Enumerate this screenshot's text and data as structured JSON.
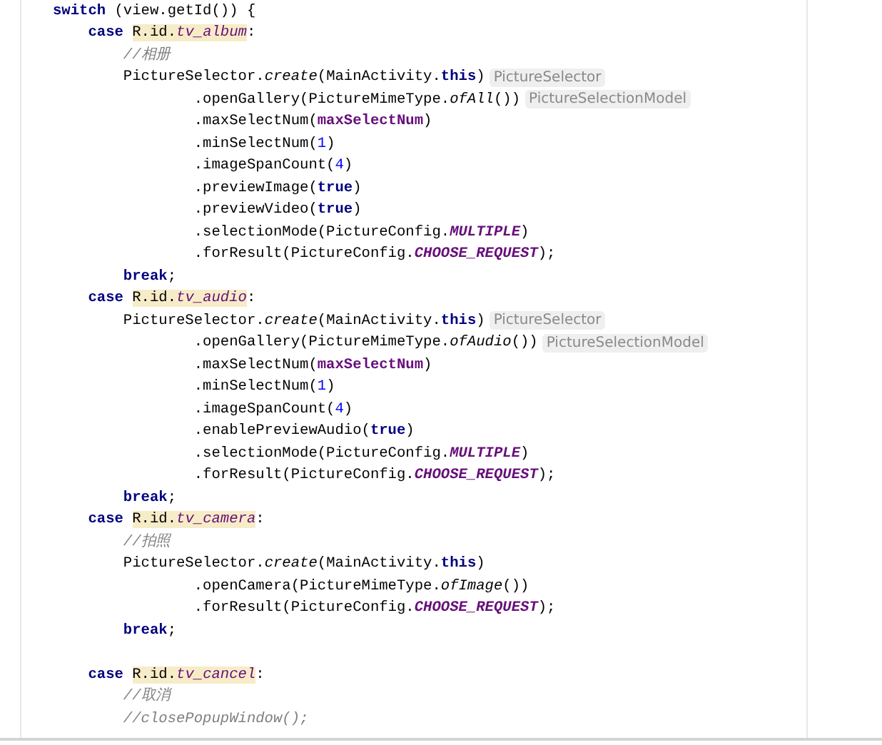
{
  "editor": {
    "lines": [
      {
        "kind": "code",
        "tokens": [
          {
            "kind": "kw",
            "text": "switch"
          },
          {
            "kind": "plain",
            "text": " (view.getId()) {"
          }
        ]
      },
      {
        "kind": "code",
        "tokens": [
          {
            "kind": "kw",
            "text": "    case "
          },
          {
            "kind": "ref",
            "text": "R.id.",
            "name": "tv_album"
          },
          {
            "kind": "plain",
            "text": ":"
          }
        ]
      },
      {
        "kind": "code",
        "tokens": [
          {
            "kind": "comment",
            "text": "        //相册"
          }
        ]
      },
      {
        "kind": "code",
        "tokens": [
          {
            "kind": "plain",
            "text": "        PictureSelector."
          },
          {
            "kind": "italic",
            "text": "create"
          },
          {
            "kind": "plain",
            "text": "(MainActivity."
          },
          {
            "kind": "kw",
            "text": "this"
          },
          {
            "kind": "plain",
            "text": ")"
          }
        ],
        "hint": "PictureSelector"
      },
      {
        "kind": "code",
        "tokens": [
          {
            "kind": "plain",
            "text": "                .openGallery(PictureMimeType."
          },
          {
            "kind": "italic",
            "text": "ofAll"
          },
          {
            "kind": "plain",
            "text": "())"
          }
        ],
        "hint": "PictureSelectionModel"
      },
      {
        "kind": "code",
        "tokens": [
          {
            "kind": "plain",
            "text": "                .maxSelectNum("
          },
          {
            "kind": "field",
            "text": "maxSelectNum"
          },
          {
            "kind": "plain",
            "text": ")"
          }
        ]
      },
      {
        "kind": "code",
        "tokens": [
          {
            "kind": "plain",
            "text": "                .minSelectNum("
          },
          {
            "kind": "num",
            "text": "1"
          },
          {
            "kind": "plain",
            "text": ")"
          }
        ]
      },
      {
        "kind": "code",
        "tokens": [
          {
            "kind": "plain",
            "text": "                .imageSpanCount("
          },
          {
            "kind": "num",
            "text": "4"
          },
          {
            "kind": "plain",
            "text": ")"
          }
        ]
      },
      {
        "kind": "code",
        "tokens": [
          {
            "kind": "plain",
            "text": "                .previewImage("
          },
          {
            "kind": "kw",
            "text": "true"
          },
          {
            "kind": "plain",
            "text": ")"
          }
        ]
      },
      {
        "kind": "code",
        "tokens": [
          {
            "kind": "plain",
            "text": "                .previewVideo("
          },
          {
            "kind": "kw",
            "text": "true"
          },
          {
            "kind": "plain",
            "text": ")"
          }
        ]
      },
      {
        "kind": "code",
        "tokens": [
          {
            "kind": "plain",
            "text": "                .selectionMode(PictureConfig."
          },
          {
            "kind": "const",
            "text": "MULTIPLE"
          },
          {
            "kind": "plain",
            "text": ")"
          }
        ]
      },
      {
        "kind": "code",
        "tokens": [
          {
            "kind": "plain",
            "text": "                .forResult(PictureConfig."
          },
          {
            "kind": "const",
            "text": "CHOOSE_REQUEST"
          },
          {
            "kind": "plain",
            "text": ");"
          }
        ]
      },
      {
        "kind": "code",
        "tokens": [
          {
            "kind": "kw",
            "text": "        break"
          },
          {
            "kind": "plain",
            "text": ";"
          }
        ]
      },
      {
        "kind": "code",
        "tokens": [
          {
            "kind": "kw",
            "text": "    case "
          },
          {
            "kind": "ref",
            "text": "R.id.",
            "name": "tv_audio"
          },
          {
            "kind": "plain",
            "text": ":"
          }
        ]
      },
      {
        "kind": "code",
        "tokens": [
          {
            "kind": "plain",
            "text": "        PictureSelector."
          },
          {
            "kind": "italic",
            "text": "create"
          },
          {
            "kind": "plain",
            "text": "(MainActivity."
          },
          {
            "kind": "kw",
            "text": "this"
          },
          {
            "kind": "plain",
            "text": ")"
          }
        ],
        "hint": "PictureSelector"
      },
      {
        "kind": "code",
        "tokens": [
          {
            "kind": "plain",
            "text": "                .openGallery(PictureMimeType."
          },
          {
            "kind": "italic",
            "text": "ofAudio"
          },
          {
            "kind": "plain",
            "text": "())"
          }
        ],
        "hint": "PictureSelectionModel"
      },
      {
        "kind": "code",
        "tokens": [
          {
            "kind": "plain",
            "text": "                .maxSelectNum("
          },
          {
            "kind": "field",
            "text": "maxSelectNum"
          },
          {
            "kind": "plain",
            "text": ")"
          }
        ]
      },
      {
        "kind": "code",
        "tokens": [
          {
            "kind": "plain",
            "text": "                .minSelectNum("
          },
          {
            "kind": "num",
            "text": "1"
          },
          {
            "kind": "plain",
            "text": ")"
          }
        ]
      },
      {
        "kind": "code",
        "tokens": [
          {
            "kind": "plain",
            "text": "                .imageSpanCount("
          },
          {
            "kind": "num",
            "text": "4"
          },
          {
            "kind": "plain",
            "text": ")"
          }
        ]
      },
      {
        "kind": "code",
        "tokens": [
          {
            "kind": "plain",
            "text": "                .enablePreviewAudio("
          },
          {
            "kind": "kw",
            "text": "true"
          },
          {
            "kind": "plain",
            "text": ")"
          }
        ]
      },
      {
        "kind": "code",
        "tokens": [
          {
            "kind": "plain",
            "text": "                .selectionMode(PictureConfig."
          },
          {
            "kind": "const",
            "text": "MULTIPLE"
          },
          {
            "kind": "plain",
            "text": ")"
          }
        ]
      },
      {
        "kind": "code",
        "tokens": [
          {
            "kind": "plain",
            "text": "                .forResult(PictureConfig."
          },
          {
            "kind": "const",
            "text": "CHOOSE_REQUEST"
          },
          {
            "kind": "plain",
            "text": ");"
          }
        ]
      },
      {
        "kind": "code",
        "tokens": [
          {
            "kind": "kw",
            "text": "        break"
          },
          {
            "kind": "plain",
            "text": ";"
          }
        ]
      },
      {
        "kind": "code",
        "tokens": [
          {
            "kind": "kw",
            "text": "    case "
          },
          {
            "kind": "ref",
            "text": "R.id.",
            "name": "tv_camera"
          },
          {
            "kind": "plain",
            "text": ":"
          }
        ]
      },
      {
        "kind": "code",
        "tokens": [
          {
            "kind": "comment",
            "text": "        //拍照"
          }
        ]
      },
      {
        "kind": "code",
        "tokens": [
          {
            "kind": "plain",
            "text": "        PictureSelector."
          },
          {
            "kind": "italic",
            "text": "create"
          },
          {
            "kind": "plain",
            "text": "(MainActivity."
          },
          {
            "kind": "kw",
            "text": "this"
          },
          {
            "kind": "plain",
            "text": ")"
          }
        ]
      },
      {
        "kind": "code",
        "tokens": [
          {
            "kind": "plain",
            "text": "                .openCamera(PictureMimeType."
          },
          {
            "kind": "italic",
            "text": "ofImage"
          },
          {
            "kind": "plain",
            "text": "())"
          }
        ]
      },
      {
        "kind": "code",
        "tokens": [
          {
            "kind": "plain",
            "text": "                .forResult(PictureConfig."
          },
          {
            "kind": "const",
            "text": "CHOOSE_REQUEST"
          },
          {
            "kind": "plain",
            "text": ");"
          }
        ]
      },
      {
        "kind": "code",
        "tokens": [
          {
            "kind": "kw",
            "text": "        break"
          },
          {
            "kind": "plain",
            "text": ";"
          }
        ]
      },
      {
        "kind": "blank"
      },
      {
        "kind": "code",
        "tokens": [
          {
            "kind": "kw",
            "text": "    case "
          },
          {
            "kind": "ref",
            "text": "R.id.",
            "name": "tv_cancel"
          },
          {
            "kind": "plain",
            "text": ":"
          }
        ]
      },
      {
        "kind": "code",
        "tokens": [
          {
            "kind": "comment",
            "text": "        //取消"
          }
        ]
      },
      {
        "kind": "code",
        "tokens": [
          {
            "kind": "comment",
            "text": "        //closePopupWindow();"
          }
        ]
      }
    ]
  }
}
